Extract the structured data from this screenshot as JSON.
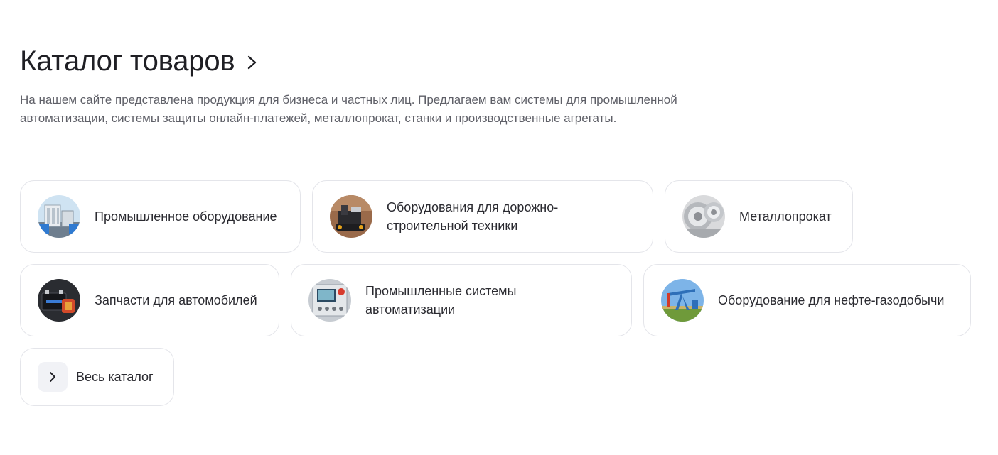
{
  "header": {
    "title": "Каталог товаров",
    "description": "На нашем сайте представлена продукция для бизнеса и частных лиц. Предлагаем вам системы для промышленной автоматизации, системы защиты онлайн-платежей, металлопрокат, станки и производственные агрегаты."
  },
  "categories": [
    {
      "label": "Промышленное оборудование",
      "icon": "industrial-equipment-image"
    },
    {
      "label": "Оборудования для дорожно-строительной техники",
      "icon": "road-construction-machinery-image"
    },
    {
      "label": "Металлопрокат",
      "icon": "metal-rolls-image"
    },
    {
      "label": "Запчасти для автомобилей",
      "icon": "car-battery-image"
    },
    {
      "label": "Промышленные системы автоматизации",
      "icon": "control-panel-image"
    },
    {
      "label": "Оборудование для нефте-газодобычи",
      "icon": "oil-pump-image"
    }
  ],
  "all_catalog": {
    "label": "Весь каталог",
    "icon": "chevron-right-icon"
  },
  "colors": {
    "text": "#1f1f24",
    "muted": "#5f6068",
    "border": "#e4e5ea",
    "icon_bg": "#f1f2f6"
  }
}
